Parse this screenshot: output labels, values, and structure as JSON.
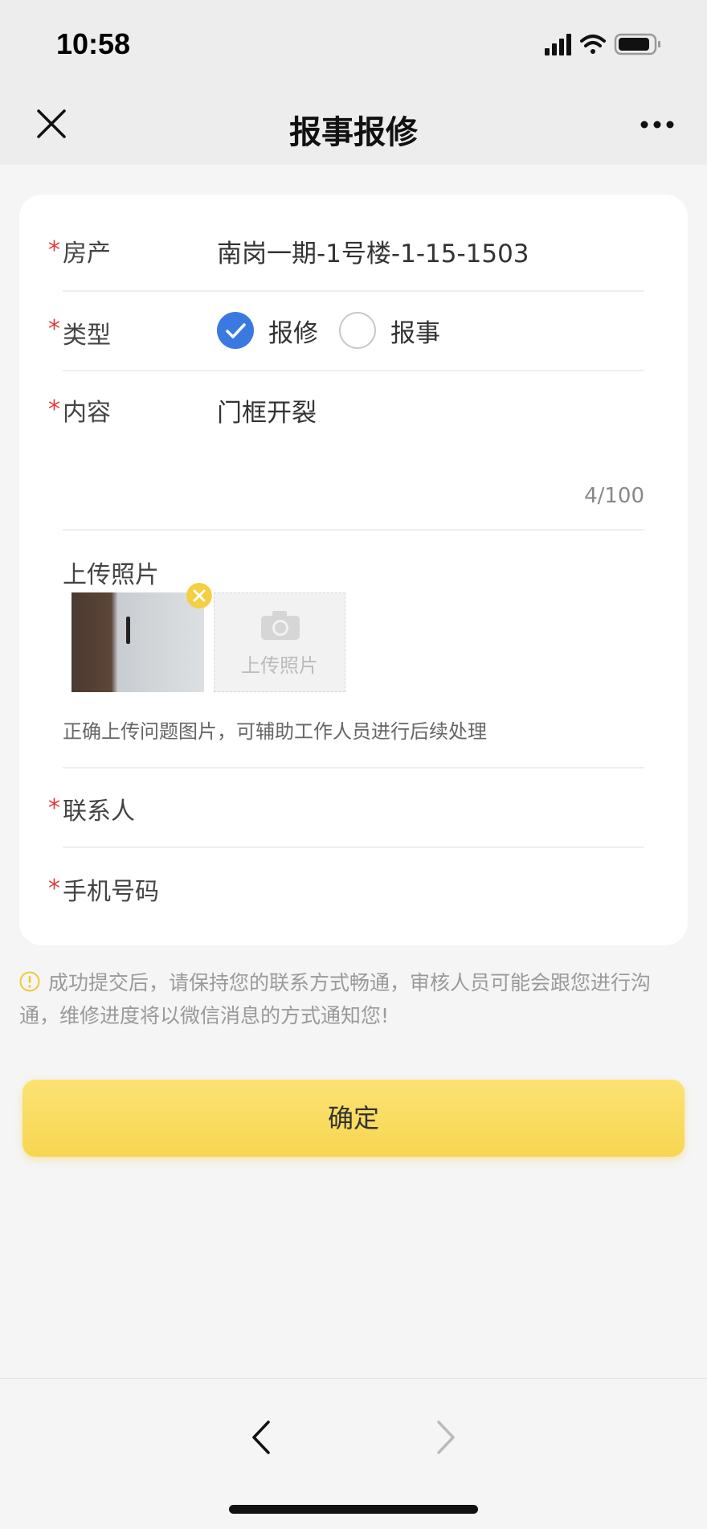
{
  "status_bar": {
    "time": "10:58"
  },
  "nav": {
    "title": "报事报修"
  },
  "form": {
    "property": {
      "label": "房产",
      "value": "南岗一期-1号楼-1-15-1503"
    },
    "type": {
      "label": "类型",
      "options": [
        {
          "label": "报修",
          "checked": true
        },
        {
          "label": "报事",
          "checked": false
        }
      ]
    },
    "content": {
      "label": "内容",
      "value": "门框开裂",
      "counter": "4/100"
    },
    "photos": {
      "label": "上传照片",
      "upload_button_label": "上传照片",
      "hint": "正确上传问题图片，可辅助工作人员进行后续处理"
    },
    "contact": {
      "label": "联系人",
      "value": ""
    },
    "phone": {
      "label": "手机号码",
      "value": ""
    },
    "required_mark": "*"
  },
  "notice": "成功提交后，请保持您的联系方式畅通，审核人员可能会跟您进行沟通，维修进度将以微信消息的方式通知您!",
  "confirm_button": "确定",
  "colors": {
    "accent_yellow": "#f7d650",
    "checked_blue": "#3a7ae0",
    "required_red": "#e23b3b"
  }
}
